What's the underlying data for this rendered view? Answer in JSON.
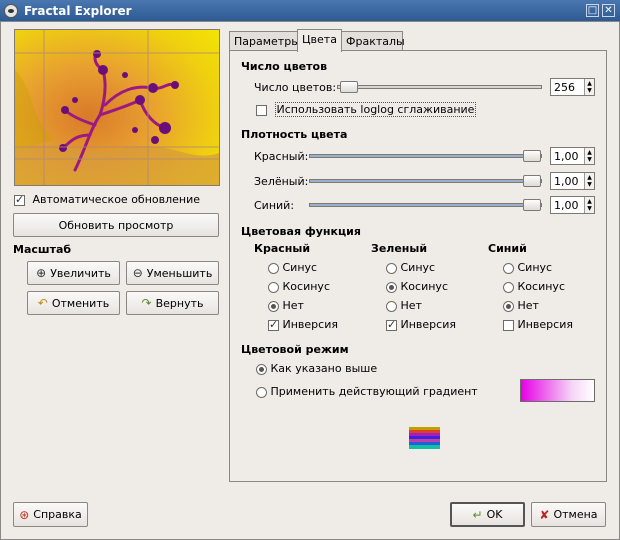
{
  "window": {
    "title": "Fractal Explorer"
  },
  "left": {
    "auto_update_label": "Автоматическое обновление",
    "auto_update_checked": true,
    "update_preview_label": "Обновить просмотр",
    "scale_label": "Масштаб",
    "zoom_in_label": "Увеличить",
    "zoom_out_label": "Уменьшить",
    "undo_label": "Отменить",
    "redo_label": "Вернуть"
  },
  "tabs": [
    {
      "label": "Параметры"
    },
    {
      "label": "Цвета"
    },
    {
      "label": "Фракталы"
    }
  ],
  "colors_tab": {
    "num_colors_section": "Число цветов",
    "num_colors_label": "Число цветов:",
    "num_colors_value": "256",
    "num_colors_fraction": 0.0,
    "loglog_label": "Использовать loglog сглаживание",
    "loglog_checked": false,
    "density_section": "Плотность цвета",
    "density": [
      {
        "label": "Красный:",
        "value": "1,00",
        "fraction": 1.0
      },
      {
        "label": "Зелёный:",
        "value": "1,00",
        "fraction": 1.0
      },
      {
        "label": "Синий:",
        "value": "1,00",
        "fraction": 1.0
      }
    ],
    "function_section": "Цветовая функция",
    "function_columns": [
      {
        "header": "Красный",
        "sine": "Синус",
        "cosine": "Косинус",
        "none": "Нет",
        "selected": "none",
        "inversion": "Инверсия",
        "inversion_checked": true
      },
      {
        "header": "Зеленый",
        "sine": "Синус",
        "cosine": "Косинус",
        "none": "Нет",
        "selected": "cosine",
        "inversion": "Инверсия",
        "inversion_checked": true
      },
      {
        "header": "Синий",
        "sine": "Синус",
        "cosine": "Косинус",
        "none": "Нет",
        "selected": "none",
        "inversion": "Инверсия",
        "inversion_checked": false
      }
    ],
    "mode_section": "Цветовой режим",
    "mode_as_above": "Как указано выше",
    "mode_gradient": "Применить действующий градиент",
    "mode_selected": "as_above",
    "gradient_colors": [
      "#e600e6",
      "#ffffff"
    ]
  },
  "footer": {
    "help_label": "Справка",
    "ok_label": "OK",
    "cancel_label": "Отмена"
  },
  "colors": {
    "titlebar": "#3a66a0",
    "fractal_bg": "#f0e000",
    "fractal_shape": "#a0107a"
  }
}
